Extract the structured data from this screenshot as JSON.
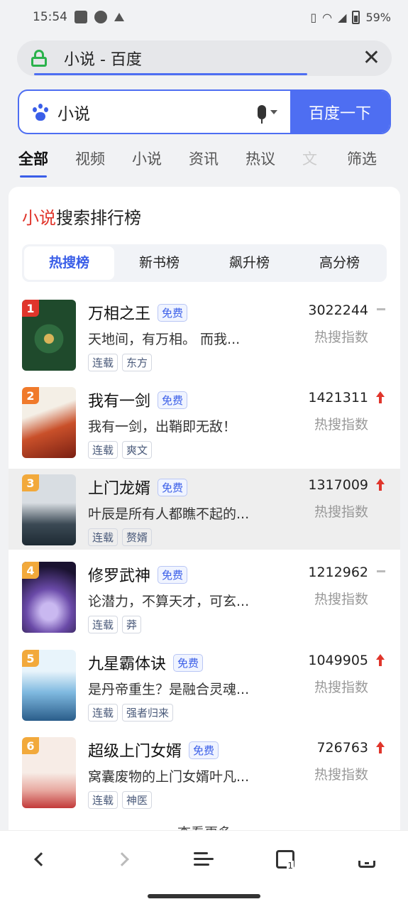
{
  "status_bar": {
    "time": "15:54",
    "battery": "59%"
  },
  "url_bar": {
    "title": "小说 - 百度"
  },
  "search": {
    "query": "小说",
    "button": "百度一下"
  },
  "tabs": [
    "全部",
    "视频",
    "小说",
    "资讯",
    "热议",
    "文"
  ],
  "filter_label": "筛选",
  "ranking": {
    "title_highlight": "小说",
    "title_rest": "搜索排行榜",
    "segments": [
      "热搜榜",
      "新书榜",
      "飙升榜",
      "高分榜"
    ],
    "sub_label": "热搜指数",
    "more_label": "查看更多",
    "items": [
      {
        "rank": "1",
        "title": "万相之王",
        "free": "免费",
        "desc": "天地间，有万相。 而我...",
        "tags": [
          "连载",
          "东方"
        ],
        "score": "3022244",
        "trend": "flat",
        "badge_color": "#e0352b"
      },
      {
        "rank": "2",
        "title": "我有一剑",
        "free": "免费",
        "desc": "我有一剑，出鞘即无敌！",
        "tags": [
          "连载",
          "爽文"
        ],
        "score": "1421311",
        "trend": "up",
        "badge_color": "#f07a2b"
      },
      {
        "rank": "3",
        "title": "上门龙婿",
        "free": "免费",
        "desc": "叶辰是所有人都瞧不起的...",
        "tags": [
          "连载",
          "赘婿"
        ],
        "score": "1317009",
        "trend": "up",
        "badge_color": "#f2a93b"
      },
      {
        "rank": "4",
        "title": "修罗武神",
        "free": "免费",
        "desc": "论潜力，不算天才，可玄...",
        "tags": [
          "连载",
          "莽"
        ],
        "score": "1212962",
        "trend": "flat",
        "badge_color": "#f2a93b"
      },
      {
        "rank": "5",
        "title": "九星霸体诀",
        "free": "免费",
        "desc": "是丹帝重生？是融合灵魂...",
        "tags": [
          "连载",
          "强者归来"
        ],
        "score": "1049905",
        "trend": "up",
        "badge_color": "#f2a93b"
      },
      {
        "rank": "6",
        "title": "超级上门女婿",
        "free": "免费",
        "desc": "窝囊废物的上门女婿叶凡...",
        "tags": [
          "连载",
          "神医"
        ],
        "score": "726763",
        "trend": "up",
        "badge_color": "#f2a93b"
      }
    ]
  },
  "bottom_nav": {
    "tab_count": "1"
  },
  "colors": {
    "accent": "#4e6ef2",
    "highlight_red": "#e0352b",
    "lock_green": "#2bb24c"
  }
}
